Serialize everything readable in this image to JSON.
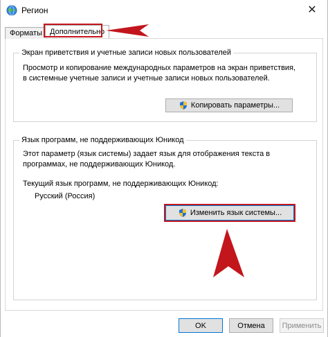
{
  "window": {
    "title": "Регион"
  },
  "tabs": [
    {
      "label": "Форматы"
    },
    {
      "label": "Дополнительно"
    }
  ],
  "welcome_group": {
    "title": "Экран приветствия и учетные записи новых пользователей",
    "line1": "Просмотр и копирование международных параметров на экран приветствия,",
    "line2": "в системные учетные записи и учетные записи новых пользователей.",
    "button_label": "Копировать параметры..."
  },
  "unicode_group": {
    "title": "Язык программ, не поддерживающих Юникод",
    "line1": "Этот параметр (язык системы) задает язык для отображения текста в",
    "line2": "программах, не поддерживающих Юникод.",
    "current_label": "Текущий язык программ, не поддерживающих Юникод:",
    "current_value": "Русский (Россия)",
    "button_label": "Изменить язык системы..."
  },
  "footer": {
    "ok": "OK",
    "cancel": "Отмена",
    "apply": "Применить"
  },
  "colors": {
    "annotation_red": "#c2161c",
    "focus_blue": "#0078d7",
    "shield_blue": "#1e6fd9",
    "shield_yellow": "#f2c12e"
  },
  "icons": [
    "globe-icon",
    "close-icon",
    "uac-shield-icon"
  ]
}
